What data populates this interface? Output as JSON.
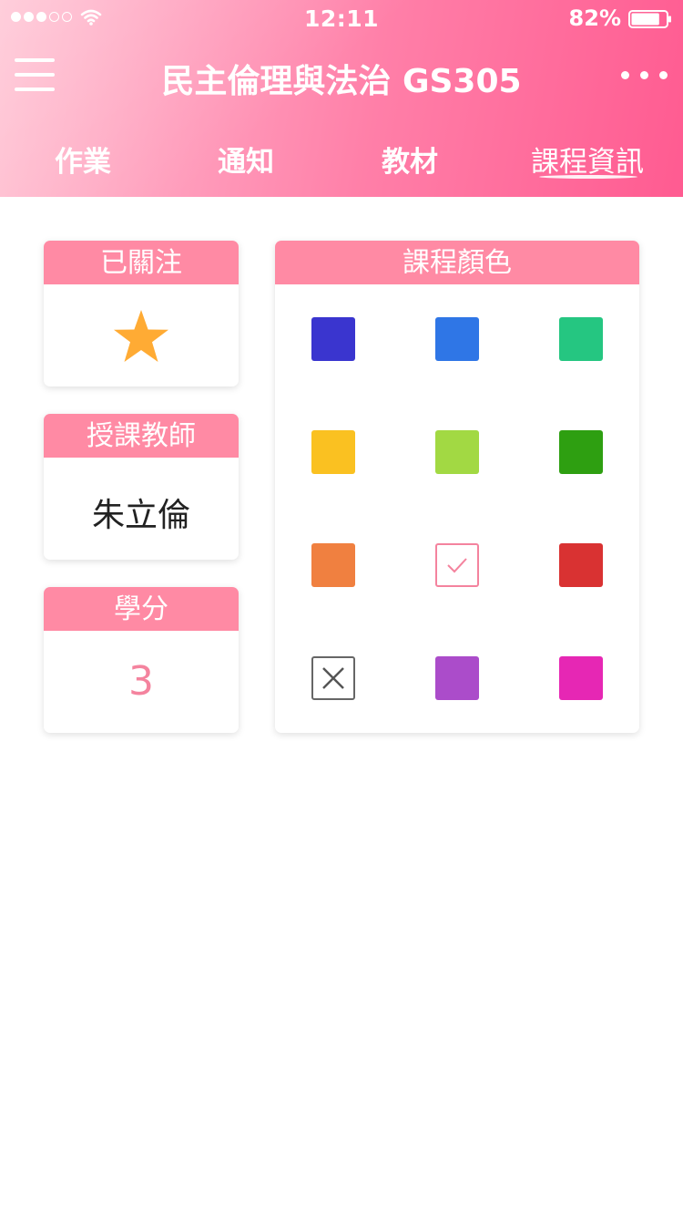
{
  "status_bar": {
    "time": "12:11",
    "battery": "82%",
    "signal_filled": 3,
    "signal_total": 5,
    "battery_level": 0.82
  },
  "nav": {
    "title": "民主倫理與法治 GS305"
  },
  "tabs": [
    {
      "label": "作業",
      "active": false
    },
    {
      "label": "通知",
      "active": false
    },
    {
      "label": "教材",
      "active": false
    },
    {
      "label": "課程資訊",
      "active": true
    }
  ],
  "info": {
    "followed": {
      "title": "已關注",
      "starred": true
    },
    "teacher": {
      "title": "授課教師",
      "name": "朱立倫"
    },
    "credits": {
      "title": "學分",
      "value": "3"
    },
    "course_color": {
      "title": "課程顏色"
    }
  },
  "colors": {
    "header": "#ff8aa4",
    "accent": "#f4839e",
    "star": "#ffab34",
    "swatches": [
      {
        "color": "#3a35cf",
        "state": "normal"
      },
      {
        "color": "#2f76e6",
        "state": "normal"
      },
      {
        "color": "#25c681",
        "state": "normal"
      },
      {
        "color": "#fac121",
        "state": "normal"
      },
      {
        "color": "#a2d943",
        "state": "normal"
      },
      {
        "color": "#2e9f11",
        "state": "normal"
      },
      {
        "color": "#f08040",
        "state": "normal"
      },
      {
        "color": "#ffffff",
        "state": "selected"
      },
      {
        "color": "#d93232",
        "state": "normal"
      },
      {
        "color": "#ffffff",
        "state": "none"
      },
      {
        "color": "#ab4cca",
        "state": "normal"
      },
      {
        "color": "#e627b4",
        "state": "normal"
      }
    ]
  }
}
